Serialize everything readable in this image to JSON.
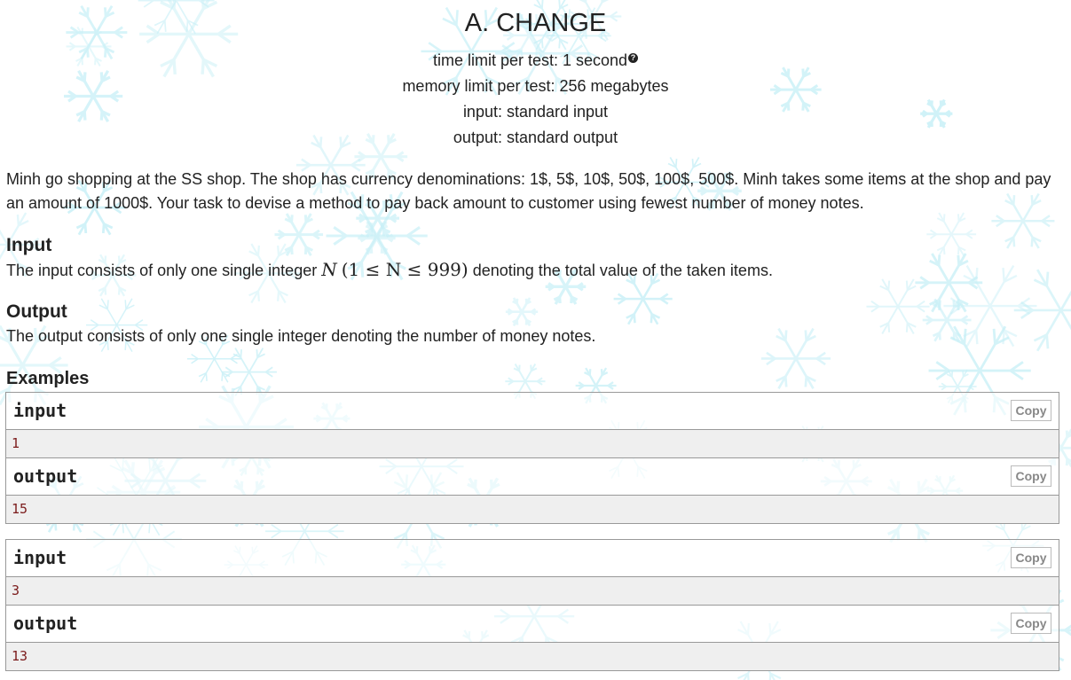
{
  "problem": {
    "title": "A. CHANGE",
    "time_limit": "time limit per test: 1 second",
    "memory_limit": "memory limit per test: 256 megabytes",
    "input_spec": "input: standard input",
    "output_spec": "output: standard output",
    "statement_1": "Minh go shopping at the SS shop. The shop has currency denominations: 1$, 5$, 10$, 50$, 100$, 500$. Minh takes some items at the shop and pay an amount of 1000$. Your task to devise a method to pay back amount to customer using fewest number of money notes.",
    "input_title": "Input",
    "input_text_before": "The input consists of only one single integer",
    "input_math_var": "N",
    "input_math_range": "(1 ≤ N ≤ 999)",
    "input_text_after": "denoting the total value of the taken items.",
    "output_title": "Output",
    "output_text": "The output consists of only one single integer denoting the number of money notes.",
    "examples_title": "Examples",
    "help_icon_glyph": "?"
  },
  "samples": [
    {
      "input_label": "input",
      "input_value": "1",
      "output_label": "output",
      "output_value": "15",
      "copy_label": "Copy"
    },
    {
      "input_label": "input",
      "input_value": "3",
      "output_label": "output",
      "output_value": "13",
      "copy_label": "Copy"
    }
  ],
  "colors": {
    "background_flakes": "#c8f0f7",
    "sample_body_bg": "#efefef",
    "sample_text": "#7b1b1b",
    "border": "#999999"
  }
}
